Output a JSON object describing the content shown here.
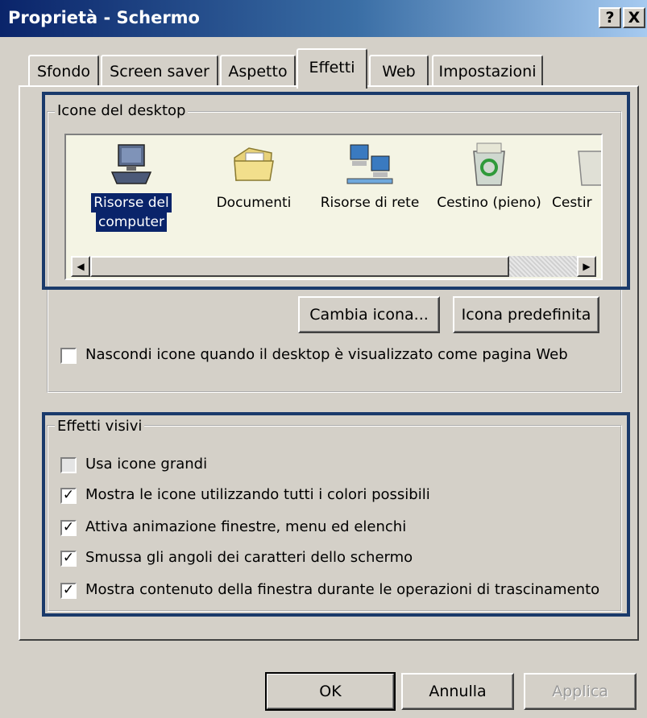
{
  "window": {
    "title": "Proprietà - Schermo",
    "help_button": "?",
    "close_button": "X"
  },
  "tabs": [
    {
      "label": "Sfondo",
      "active": false
    },
    {
      "label": "Screen saver",
      "active": false
    },
    {
      "label": "Aspetto",
      "active": false
    },
    {
      "label": "Effetti",
      "active": true
    },
    {
      "label": "Web",
      "active": false
    },
    {
      "label": "Impostazioni",
      "active": false
    }
  ],
  "desktop_icons": {
    "group_label": "Icone del desktop",
    "items": [
      {
        "caption_line1": "Risorse del",
        "caption_line2": "computer",
        "icon": "computer-icon",
        "selected": true
      },
      {
        "caption_line1": "Documenti",
        "caption_line2": "",
        "icon": "folder-icon",
        "selected": false
      },
      {
        "caption_line1": "Risorse di rete",
        "caption_line2": "",
        "icon": "network-icon",
        "selected": false
      },
      {
        "caption_line1": "Cestino (pieno)",
        "caption_line2": "",
        "icon": "recycle-bin-full-icon",
        "selected": false
      },
      {
        "caption_line1": "Cestir",
        "caption_line2": "",
        "icon": "recycle-bin-empty-icon",
        "selected": false
      }
    ],
    "change_icon_button": "Cambia icona...",
    "default_icon_button": "Icona predefinita",
    "hide_icons_checkbox": {
      "label": "Nascondi icone quando il desktop è visualizzato come pagina Web",
      "checked": false
    }
  },
  "visual_effects": {
    "group_label": "Effetti visivi",
    "options": [
      {
        "label": "Usa icone grandi",
        "checked": false
      },
      {
        "label": "Mostra le icone utilizzando tutti i colori possibili",
        "checked": true
      },
      {
        "label": "Attiva animazione finestre, menu ed elenchi",
        "checked": true
      },
      {
        "label": "Smussa gli angoli dei caratteri dello schermo",
        "checked": true
      },
      {
        "label": "Mostra contenuto della finestra durante le operazioni di trascinamento",
        "checked": true
      }
    ]
  },
  "footer": {
    "ok_button": "OK",
    "cancel_button": "Annulla",
    "apply_button": "Applica"
  },
  "colors": {
    "titlebar_start": "#0a246a",
    "face": "#d4d0c8",
    "selection": "#0a246a",
    "highlight_box": "#1a3a6b"
  }
}
